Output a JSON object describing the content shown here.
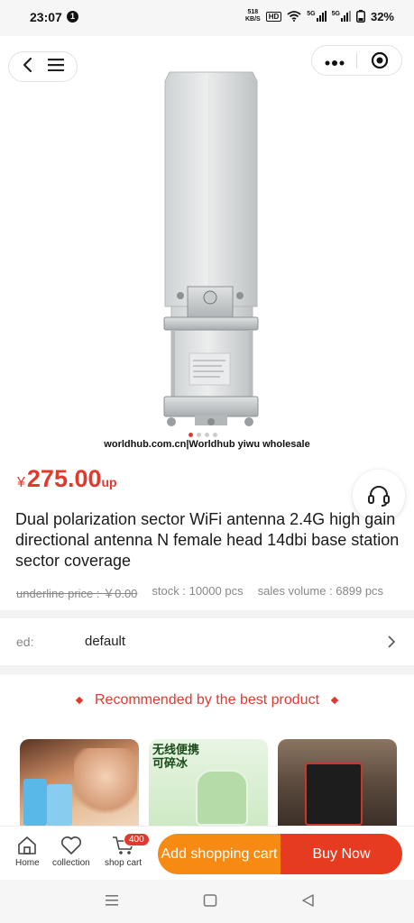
{
  "status_bar": {
    "time": "23:07",
    "notification_count": "1",
    "net_speed_value": "518",
    "net_speed_unit": "KB/S",
    "hd_label": "HD",
    "signal1_label": "5G",
    "signal2_label": "5G",
    "battery": "32%"
  },
  "product": {
    "watermark": "worldhub.com.cn|Worldhub yiwu wholesale",
    "image_count": 4,
    "active_image_index": 0,
    "currency": "¥",
    "price": "275.00",
    "price_suffix": "up",
    "title": "Dual polarization sector WiFi antenna 2.4G high gain directional antenna N female head 14dbi base station sector coverage",
    "underline_price": "underline price : ￥0.00",
    "stock": "stock : 10000 pcs",
    "sales_volume": "sales volume : 6899 pcs"
  },
  "spec": {
    "label": "ed:",
    "value": "default"
  },
  "recommended": {
    "header": "Recommended by the best product",
    "cards": [
      {
        "text": ""
      },
      {
        "text_line1": "无线便携",
        "text_line2": "可碎冰"
      },
      {
        "text": ""
      }
    ]
  },
  "action_bar": {
    "home_label": "Home",
    "collection_label": "collection",
    "cart_label": "shop cart",
    "cart_count": "400",
    "add_cart_label": "Add shopping cart",
    "buy_now_label": "Buy Now"
  },
  "colors": {
    "accent": "#e03a2f",
    "add_cart": "#f78a12",
    "buy_now": "#e63b21"
  }
}
